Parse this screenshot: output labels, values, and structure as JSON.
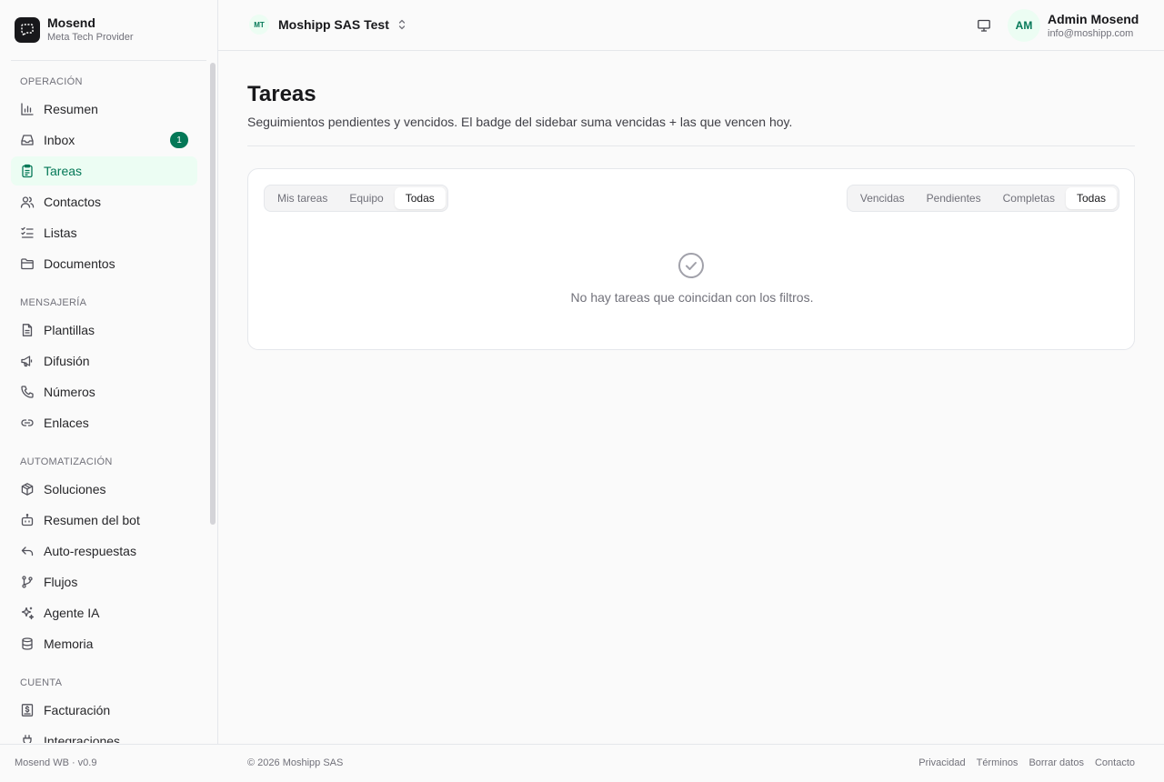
{
  "brand": {
    "name": "Mosend",
    "subtitle": "Meta Tech Provider",
    "logo_icon": "chat-dashed-icon"
  },
  "sidebar": {
    "sections": [
      {
        "label": "OPERACIÓN",
        "items": [
          {
            "label": "Resumen",
            "icon": "bar-chart-icon"
          },
          {
            "label": "Inbox",
            "icon": "inbox-icon",
            "badge": "1"
          },
          {
            "label": "Tareas",
            "icon": "clipboard-icon",
            "active": true
          },
          {
            "label": "Contactos",
            "icon": "users-icon"
          },
          {
            "label": "Listas",
            "icon": "list-checks-icon"
          },
          {
            "label": "Documentos",
            "icon": "folder-icon"
          }
        ]
      },
      {
        "label": "MENSAJERÍA",
        "items": [
          {
            "label": "Plantillas",
            "icon": "file-text-icon"
          },
          {
            "label": "Difusión",
            "icon": "megaphone-icon"
          },
          {
            "label": "Números",
            "icon": "phone-icon"
          },
          {
            "label": "Enlaces",
            "icon": "link-icon"
          }
        ]
      },
      {
        "label": "AUTOMATIZACIÓN",
        "items": [
          {
            "label": "Soluciones",
            "icon": "package-icon"
          },
          {
            "label": "Resumen del bot",
            "icon": "bot-icon"
          },
          {
            "label": "Auto-respuestas",
            "icon": "reply-icon"
          },
          {
            "label": "Flujos",
            "icon": "git-branch-icon"
          },
          {
            "label": "Agente IA",
            "icon": "sparkles-icon"
          },
          {
            "label": "Memoria",
            "icon": "database-icon"
          }
        ]
      },
      {
        "label": "CUENTA",
        "items": [
          {
            "label": "Facturación",
            "icon": "receipt-icon"
          },
          {
            "label": "Integraciones",
            "icon": "plug-icon"
          }
        ]
      }
    ],
    "version": "Mosend WB · v0.9"
  },
  "header": {
    "org_initials": "MT",
    "org_name": "Moshipp SAS Test",
    "user_initials": "AM",
    "user_name": "Admin Mosend",
    "user_email": "info@moshipp.com"
  },
  "main": {
    "title": "Tareas",
    "description": "Seguimientos pendientes y vencidos. El badge del sidebar suma vencidas + las que vencen hoy.",
    "scope_tabs": [
      "Mis tareas",
      "Equipo",
      "Todas"
    ],
    "scope_active": "Todas",
    "status_tabs": [
      "Vencidas",
      "Pendientes",
      "Completas",
      "Todas"
    ],
    "status_active": "Todas",
    "empty_text": "No hay tareas que coincidan con los filtros."
  },
  "footer": {
    "copyright": "© 2026 Moshipp SAS",
    "links": [
      "Privacidad",
      "Términos",
      "Borrar datos",
      "Contacto"
    ]
  },
  "colors": {
    "accent": "#047857",
    "accent_bg": "#ecfdf3",
    "border": "#e5e7eb",
    "muted": "#71717a"
  }
}
